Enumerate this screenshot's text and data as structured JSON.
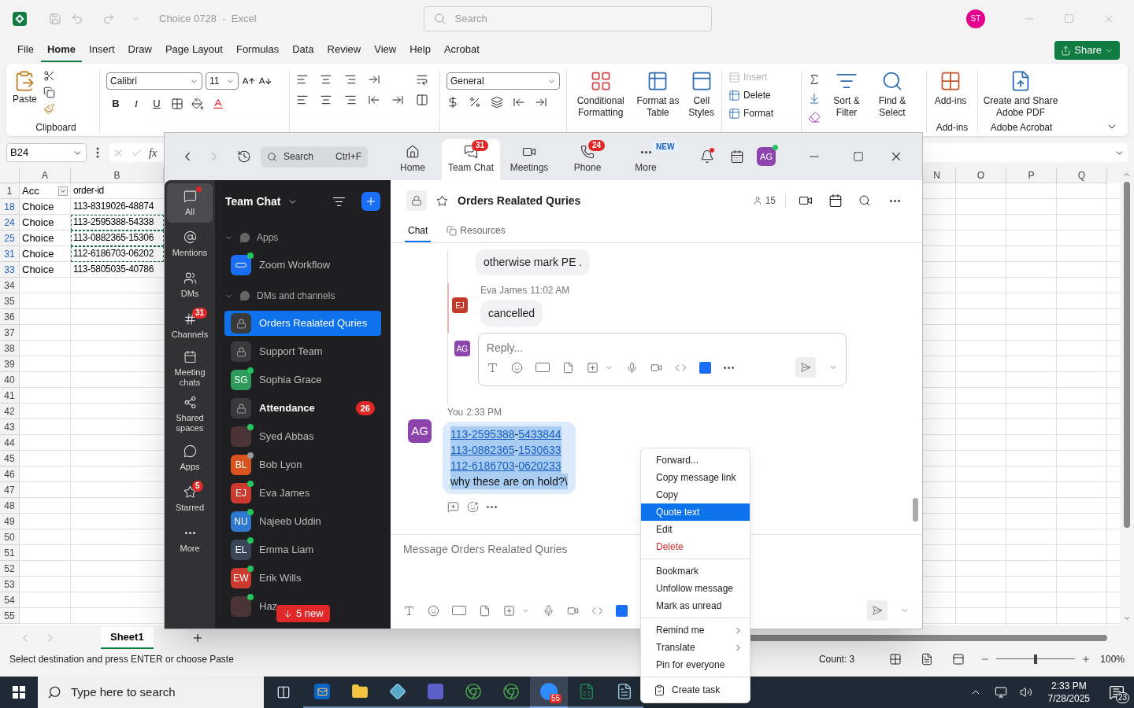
{
  "excel": {
    "title_bar": {
      "title": "Choice 0728  -  Excel",
      "search": {
        "placeholder": "Search"
      },
      "avatar": "ST"
    },
    "menu_tabs": [
      {
        "label": "File",
        "selected": false
      },
      {
        "label": "Home",
        "selected": true
      },
      {
        "label": "Insert",
        "selected": false
      },
      {
        "label": "Draw",
        "selected": false
      },
      {
        "label": "Page Layout",
        "selected": false
      },
      {
        "label": "Formulas",
        "selected": false
      },
      {
        "label": "Data",
        "selected": false
      },
      {
        "label": "Review",
        "selected": false
      },
      {
        "label": "View",
        "selected": false
      },
      {
        "label": "Help",
        "selected": false
      },
      {
        "label": "Acrobat",
        "selected": false
      }
    ],
    "share": "Share",
    "ribbon": {
      "clipboard": {
        "paste": "Paste",
        "label": "Clipboard"
      },
      "font": {
        "family": "Calibri",
        "size": "11",
        "format_buttons": [
          "B",
          "I",
          "U"
        ]
      },
      "number": {
        "format": "General"
      },
      "styles": [
        "Conditional Formatting",
        "Format as Table",
        "Cell Styles"
      ],
      "cells": [
        {
          "label": "Insert",
          "disabled": true
        },
        {
          "label": "Delete",
          "disabled": false
        },
        {
          "label": "Format",
          "disabled": false
        }
      ],
      "editing": [
        "Sort & Filter",
        "Find & Select"
      ],
      "addins": {
        "button": "Add-ins",
        "label": "Add-ins"
      },
      "adobe": {
        "button": "Create and Share Adobe PDF",
        "label": "Adobe Acrobat"
      }
    },
    "name_box": "B24",
    "formula_label": "fx",
    "columns_left": [
      "A",
      "B"
    ],
    "columns_right": [
      "N",
      "O",
      "P",
      "Q"
    ],
    "header_row": {
      "row": "1",
      "cells": [
        "Acc",
        "order-id"
      ]
    },
    "rows": [
      {
        "row": "18",
        "filtered": true,
        "copied": false,
        "cells": [
          "Choice",
          "113-8319026-48874"
        ]
      },
      {
        "row": "24",
        "filtered": true,
        "copied": true,
        "cells": [
          "Choice",
          "113-2595388-54338"
        ]
      },
      {
        "row": "25",
        "filtered": true,
        "copied": true,
        "cells": [
          "Choice",
          "113-0882365-15306"
        ]
      },
      {
        "row": "31",
        "filtered": true,
        "copied": true,
        "cells": [
          "Choice",
          "112-6186703-06202"
        ]
      },
      {
        "row": "33",
        "filtered": true,
        "copied": false,
        "cells": [
          "Choice",
          "113-5805035-40786"
        ]
      }
    ],
    "empty_rows": [
      "34",
      "35",
      "36",
      "37",
      "38",
      "39",
      "40",
      "41",
      "42",
      "43",
      "44",
      "45",
      "46",
      "47",
      "48",
      "49",
      "50",
      "51",
      "52",
      "53",
      "54",
      "55"
    ],
    "sheet_tabs": [
      {
        "label": "Sheet1",
        "selected": true
      }
    ],
    "status": {
      "message": "Select destination and press ENTER or choose Paste",
      "count": "Count: 3",
      "zoom": {
        "level": 0.5,
        "reading": "100%"
      }
    }
  },
  "zoom": {
    "search": {
      "placeholder": "Search",
      "shortcut": "Ctrl+F"
    },
    "nav": [
      {
        "label": "Home",
        "selected": false
      },
      {
        "label": "Team Chat",
        "selected": true,
        "badge": "31"
      },
      {
        "label": "Meetings",
        "selected": false
      },
      {
        "label": "Phone",
        "selected": false,
        "badge": "24"
      },
      {
        "label": "More",
        "selected": false,
        "tag": "NEW"
      }
    ],
    "profile": "AG",
    "rail": [
      {
        "label": "All",
        "selected": true,
        "dot": true
      },
      {
        "label": "Mentions",
        "selected": false
      },
      {
        "label": "DMs",
        "selected": false
      },
      {
        "label": "Channels",
        "selected": false,
        "badge": "31"
      },
      {
        "label": "Meeting chats",
        "selected": false
      },
      {
        "label": "Shared spaces",
        "selected": false
      },
      {
        "label": "Apps",
        "selected": false
      },
      {
        "label": "Starred",
        "selected": false,
        "badge": "5"
      },
      {
        "label": "More",
        "selected": false
      }
    ],
    "list_title": "Team Chat",
    "sections": [
      {
        "title": "Apps",
        "expanded": true,
        "items": [
          {
            "name": "Zoom Workflow",
            "kind": "app",
            "online": true,
            "selected": false,
            "unread": false
          }
        ]
      },
      {
        "title": "DMs and channels",
        "expanded": true,
        "items": [
          {
            "name": "Orders Realated Quries",
            "kind": "lock",
            "selected": true,
            "unread": false
          },
          {
            "name": "Support Team",
            "kind": "lock",
            "selected": false,
            "unread": false
          },
          {
            "name": "Sophia Grace",
            "kind": "initials",
            "initials": "SG",
            "color": "#2e9b5a",
            "online": true,
            "selected": false,
            "unread": false
          },
          {
            "name": "Attendance",
            "kind": "lock",
            "selected": false,
            "unread": true,
            "badge": "26"
          },
          {
            "name": "Syed Abbas",
            "kind": "photo",
            "online": true,
            "selected": false,
            "unread": false
          },
          {
            "name": "Bob Lyon",
            "kind": "initials",
            "initials": "BL",
            "color": "#d9541e",
            "online": false,
            "selected": false,
            "unread": false
          },
          {
            "name": "Eva James",
            "kind": "initials",
            "initials": "EJ",
            "color": "#cc3a2f",
            "online": true,
            "selected": false,
            "unread": false
          },
          {
            "name": "Najeeb Uddin",
            "kind": "initials",
            "initials": "NU",
            "color": "#2f78cf",
            "online": true,
            "selected": false,
            "unread": false
          },
          {
            "name": "Emma Liam",
            "kind": "initials",
            "initials": "EL",
            "color": "#3a4658",
            "online": true,
            "selected": false,
            "unread": false
          },
          {
            "name": "Erik Wills",
            "kind": "initials",
            "initials": "EW",
            "color": "#cc3a2f",
            "online": true,
            "selected": false,
            "unread": false
          },
          {
            "name": "Haz",
            "kind": "photo",
            "online": true,
            "selected": false,
            "unread": false
          }
        ]
      }
    ],
    "new_pill": "5 new",
    "channel": {
      "title": "Orders Realated Quries",
      "members": "15",
      "tabs": [
        {
          "label": "Chat",
          "selected": true
        },
        {
          "label": "Resources",
          "selected": false
        }
      ]
    },
    "messages": [
      {
        "kind": "bubble",
        "text": "otherwise mark PE ."
      },
      {
        "kind": "thread",
        "sender": "Eva James",
        "time": "11:02 AM",
        "avatar": "EJ",
        "color": "#c0392b",
        "text": "cancelled"
      },
      {
        "kind": "reply_box",
        "avatar": "AG",
        "placeholder": "Reply..."
      },
      {
        "kind": "own",
        "sender": "You",
        "time": "2:33 PM",
        "avatar": "AG",
        "selected": true,
        "lines": [
          [
            {
              "text": "113-2595388",
              "link": true
            },
            {
              "text": "-",
              "link": false
            },
            {
              "text": "5433844",
              "link": true
            }
          ],
          [
            {
              "text": "113-0882365",
              "link": true
            },
            {
              "text": "-",
              "link": false
            },
            {
              "text": "1530633",
              "link": true
            }
          ],
          [
            {
              "text": "112-6186703",
              "link": true
            },
            {
              "text": "-",
              "link": false
            },
            {
              "text": "0620233",
              "link": true
            }
          ],
          [
            {
              "text": "why these are on hold?\\",
              "link": false
            }
          ]
        ]
      }
    ],
    "composer": {
      "placeholder": "Message Orders Realated Quries"
    }
  },
  "context_menu": {
    "groups": [
      [
        {
          "label": "Forward...",
          "kind": "item",
          "selected": false
        },
        {
          "label": "Copy message link",
          "kind": "item",
          "selected": false
        },
        {
          "label": "Copy",
          "kind": "item",
          "selected": false
        },
        {
          "label": "Quote text",
          "kind": "item",
          "selected": true
        },
        {
          "label": "Edit",
          "kind": "item",
          "selected": false
        },
        {
          "label": "Delete",
          "kind": "danger",
          "selected": false
        }
      ],
      [
        {
          "label": "Bookmark",
          "kind": "item",
          "selected": false
        },
        {
          "label": "Unfollow message",
          "kind": "item",
          "selected": false
        },
        {
          "label": "Mark as unread",
          "kind": "item",
          "selected": false
        }
      ],
      [
        {
          "label": "Remind me",
          "kind": "submenu",
          "selected": false
        },
        {
          "label": "Translate",
          "kind": "submenu",
          "selected": false
        },
        {
          "label": "Pin for everyone",
          "kind": "item",
          "selected": false
        }
      ],
      [
        {
          "label": "Create task",
          "kind": "task",
          "selected": false
        }
      ]
    ]
  },
  "taskbar": {
    "search": {
      "placeholder": "Type here to search"
    },
    "apps": [
      {
        "kind": "outlook",
        "active": false
      },
      {
        "kind": "files",
        "active": false
      },
      {
        "kind": "gem",
        "active": false
      },
      {
        "kind": "teams",
        "active": false
      },
      {
        "kind": "chrome",
        "active": false
      },
      {
        "kind": "chrome",
        "active": false
      },
      {
        "kind": "zoom",
        "active": true,
        "badge": "55"
      },
      {
        "kind": "excel",
        "active": false
      },
      {
        "kind": "doc",
        "active": false
      }
    ],
    "time": "2:33 PM",
    "date": "7/28/2025",
    "notifications": "23"
  }
}
